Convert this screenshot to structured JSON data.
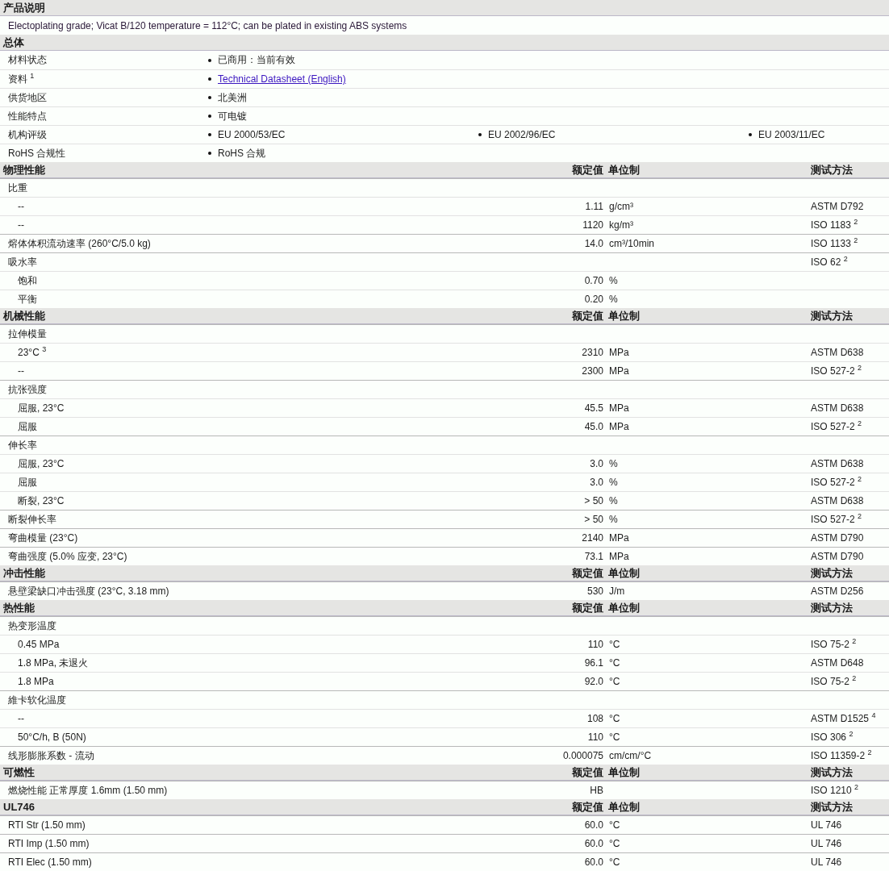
{
  "sections": [
    {
      "kind": "description",
      "title": "产品说明",
      "text": "Electoplating grade; Vicat B/120 temperature = 112°C; can be plated in existing ABS systems"
    },
    {
      "kind": "general",
      "title": "总体",
      "rows": [
        {
          "label": "材料状态",
          "items": [
            {
              "kind": "text",
              "text": "已商用：当前有效"
            }
          ]
        },
        {
          "label": "资料 $^{1}$",
          "items": [
            {
              "kind": "link",
              "text": "Technical Datasheet (English)"
            }
          ]
        },
        {
          "label": "供货地区",
          "items": [
            {
              "kind": "text",
              "text": "北美洲"
            }
          ]
        },
        {
          "label": "性能特点",
          "items": [
            {
              "kind": "text",
              "text": "可电镀"
            }
          ]
        },
        {
          "label": "机构评级",
          "items": [
            {
              "kind": "text",
              "text": "EU 2000/53/EC"
            },
            {
              "kind": "text",
              "text": "EU 2002/96/EC"
            },
            {
              "kind": "text",
              "text": "EU 2003/11/EC"
            }
          ]
        },
        {
          "label": "RoHS 合规性",
          "items": [
            {
              "kind": "text",
              "text": "RoHS 合规"
            }
          ]
        }
      ]
    },
    {
      "kind": "properties",
      "title": "物理性能",
      "headings": {
        "value": "额定值",
        "unit": "单位制",
        "method": "测试方法"
      },
      "rows": [
        {
          "label": "比重",
          "children": [
            {
              "label": "--",
              "value": "1.11",
              "unit": "g/cm³",
              "method": "ASTM D792"
            },
            {
              "label": "--",
              "value": "1120",
              "unit": "kg/m³",
              "method": "ISO 1183 $^{2}$"
            }
          ]
        },
        {
          "label": "熔体体积流动速率 (260°C/5.0 kg)",
          "value": "14.0",
          "unit": "cm³/10min",
          "method": "ISO 1133 $^{2}$"
        },
        {
          "label": "吸水率",
          "method": "ISO 62 $^{2}$",
          "children": [
            {
              "label": "饱和",
              "value": "0.70",
              "unit": "%"
            },
            {
              "label": "平衡",
              "value": "0.20",
              "unit": "%"
            }
          ]
        }
      ]
    },
    {
      "kind": "properties",
      "title": "机械性能",
      "headings": {
        "value": "额定值",
        "unit": "单位制",
        "method": "测试方法"
      },
      "rows": [
        {
          "label": "拉伸模量",
          "children": [
            {
              "label": "23°C $^{3}$",
              "value": "2310",
              "unit": "MPa",
              "method": "ASTM D638"
            },
            {
              "label": "--",
              "value": "2300",
              "unit": "MPa",
              "method": "ISO 527-2 $^{2}$"
            }
          ]
        },
        {
          "label": "抗张强度",
          "children": [
            {
              "label": "屈服, 23°C",
              "value": "45.5",
              "unit": "MPa",
              "method": "ASTM D638"
            },
            {
              "label": "屈服",
              "value": "45.0",
              "unit": "MPa",
              "method": "ISO 527-2 $^{2}$"
            }
          ]
        },
        {
          "label": "伸长率",
          "children": [
            {
              "label": "屈服, 23°C",
              "value": "3.0",
              "unit": "%",
              "method": "ASTM D638"
            },
            {
              "label": "屈服",
              "value": "3.0",
              "unit": "%",
              "method": "ISO 527-2 $^{2}$"
            },
            {
              "label": "断裂, 23°C",
              "value": "> 50",
              "unit": "%",
              "method": "ASTM D638"
            }
          ]
        },
        {
          "label": "断裂伸长率",
          "value": "> 50",
          "unit": "%",
          "method": "ISO 527-2 $^{2}$"
        },
        {
          "label": "弯曲模量 (23°C)",
          "value": "2140",
          "unit": "MPa",
          "method": "ASTM D790"
        },
        {
          "label": "弯曲强度 (5.0% 应变, 23°C)",
          "value": "73.1",
          "unit": "MPa",
          "method": "ASTM D790"
        }
      ]
    },
    {
      "kind": "properties",
      "title": "冲击性能",
      "headings": {
        "value": "额定值",
        "unit": "单位制",
        "method": "测试方法"
      },
      "rows": [
        {
          "label": "悬壁梁缺口冲击强度 (23°C, 3.18 mm)",
          "value": "530",
          "unit": "J/m",
          "method": "ASTM D256"
        }
      ]
    },
    {
      "kind": "properties",
      "title": "热性能",
      "headings": {
        "value": "额定值",
        "unit": "单位制",
        "method": "测试方法"
      },
      "rows": [
        {
          "label": "热变形温度",
          "children": [
            {
              "label": "0.45 MPa",
              "value": "110",
              "unit": "°C",
              "method": "ISO 75-2 $^{2}$"
            },
            {
              "label": "1.8 MPa, 未退火",
              "value": "96.1",
              "unit": "°C",
              "method": "ASTM D648"
            },
            {
              "label": "1.8 MPa",
              "value": "92.0",
              "unit": "°C",
              "method": "ISO 75-2 $^{2}$"
            }
          ]
        },
        {
          "label": "維卡软化温度",
          "children": [
            {
              "label": "--",
              "value": "108",
              "unit": "°C",
              "method": "ASTM D1525 $^{4}$"
            },
            {
              "label": "50°C/h, B (50N)",
              "value": "110",
              "unit": "°C",
              "method": "ISO 306 $^{2}$"
            }
          ]
        },
        {
          "label": "线形膨胀系数 - 流动",
          "value": "0.000075",
          "unit": "cm/cm/°C",
          "method": "ISO 11359-2 $^{2}$"
        }
      ]
    },
    {
      "kind": "properties",
      "title": "可燃性",
      "headings": {
        "value": "额定值",
        "unit": "单位制",
        "method": "测试方法"
      },
      "rows": [
        {
          "label": "燃烧性能 正常厚度 1.6mm (1.50 mm)",
          "value": "HB",
          "method": "ISO 1210 $^{2}$"
        }
      ]
    },
    {
      "kind": "properties",
      "title": "UL746",
      "headings": {
        "value": "额定值",
        "unit": "单位制",
        "method": "测试方法"
      },
      "rows": [
        {
          "label": "RTI Str (1.50 mm)",
          "value": "60.0",
          "unit": "°C",
          "method": "UL 746"
        },
        {
          "label": "RTI Imp (1.50 mm)",
          "value": "60.0",
          "unit": "°C",
          "method": "UL 746"
        },
        {
          "label": "RTI Elec (1.50 mm)",
          "value": "60.0",
          "unit": "°C",
          "method": "UL 746"
        }
      ]
    }
  ]
}
